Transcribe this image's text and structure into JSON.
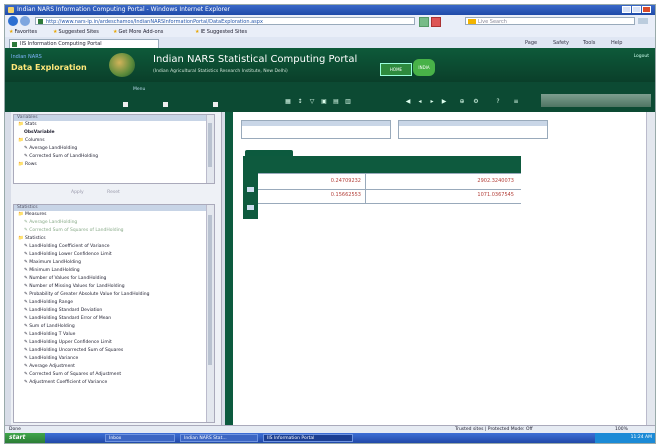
{
  "window": {
    "title": "Indian NARS Information Computing Portal - Windows Internet Explorer"
  },
  "browser": {
    "url": "http://www.nars-ip.in/ardeschamos/IndianNARSInformationPortal/DataExploration.aspx",
    "search_placeholder": "Live Search",
    "favorites": [
      "Favorites",
      "Suggested Sites",
      "Get More Add-ons",
      "IE Suggested Sites"
    ],
    "tab_title": "IIS Information Computing Portal",
    "commands": [
      "Page",
      "Safety",
      "Tools",
      "Help"
    ]
  },
  "header": {
    "logo_top": "Indian NARS",
    "logo": "Data Exploration",
    "portal_title": "Indian NARS Statistical Computing Portal",
    "portal_subtitle": "(Indian Agricultural Statistics Research Institute, New Delhi)",
    "badge_left": "HOME",
    "badge_right": "INDIA",
    "top_link": "Logout"
  },
  "toolbar": {
    "menu_label": "Menu"
  },
  "left_panel": {
    "panel1_title": "Variables",
    "panel1_rows": [
      "Stats",
      "ObsVariable",
      "Columns",
      "Average LandHolding",
      "Corrected Sum of LandHolding",
      "Rows"
    ],
    "apply_label": "Apply",
    "reset_label": "Reset",
    "panel2_title": "Statistics",
    "panel2_rows": [
      "Measures",
      "Average LandHolding",
      "Corrected Sum of Squares of LandHolding",
      "Statistics",
      "LandHolding Coefficient of Variance",
      "LandHolding Lower Confidence Limit",
      "Maximum LandHolding",
      "Minimum LandHolding",
      "Number of Values for LandHolding",
      "Number of Missing Values for LandHolding",
      "Probability of Greater Absolute Value for LandHolding",
      "LandHolding Range",
      "LandHolding Standard Deviation",
      "LandHolding Standard Error of Mean",
      "Sum of LandHolding",
      "LandHolding T Value",
      "LandHolding Upper Confidence Limit",
      "LandHolding Uncorrected Sum of Squares",
      "LandHolding Variance",
      "Average Adjustment",
      "Corrected Sum of Squares of Adjustment",
      "Adjustment Coefficient of Variance"
    ]
  },
  "grid": {
    "rows": [
      {
        "c1": "0.24709232",
        "c2": "2902.3240073"
      },
      {
        "c1": "0.15662553",
        "c2": "1071.0367545"
      }
    ]
  },
  "status": {
    "left": "Done",
    "zone": "Trusted sites | Protected Mode: Off",
    "zoom": "100%"
  },
  "taskbar": {
    "start": "start",
    "tasks": [
      "Inbox",
      "Indian NARS Stat...",
      "IIS Information Portal"
    ],
    "clock": "11:24 AM"
  }
}
